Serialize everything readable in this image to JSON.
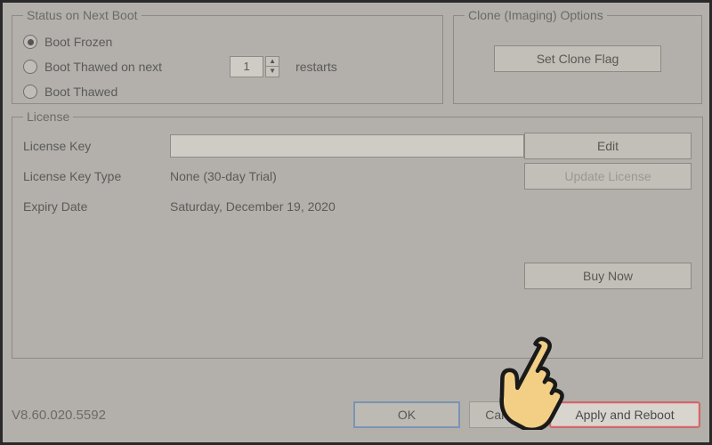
{
  "status_group": {
    "legend": "Status on Next Boot",
    "radios": [
      {
        "label": "Boot Frozen",
        "checked": true
      },
      {
        "label": "Boot Thawed on next",
        "checked": false
      },
      {
        "label": "Boot Thawed",
        "checked": false
      }
    ],
    "restarts_value": "1",
    "restarts_label": "restarts"
  },
  "clone_group": {
    "legend": "Clone (Imaging) Options",
    "set_flag_label": "Set Clone Flag"
  },
  "license_group": {
    "legend": "License",
    "key_label": "License Key",
    "key_value": "",
    "type_label": "License Key Type",
    "type_value": "None (30-day Trial)",
    "expiry_label": "Expiry Date",
    "expiry_value": "Saturday, December 19, 2020",
    "edit_label": "Edit",
    "update_label": "Update License",
    "buy_label": "Buy Now"
  },
  "footer": {
    "version": "V8.60.020.5592",
    "ok": "OK",
    "cancel": "Cancel",
    "apply": "Apply and Reboot"
  },
  "icons": {
    "hand_cursor": "hand-point-icon"
  }
}
